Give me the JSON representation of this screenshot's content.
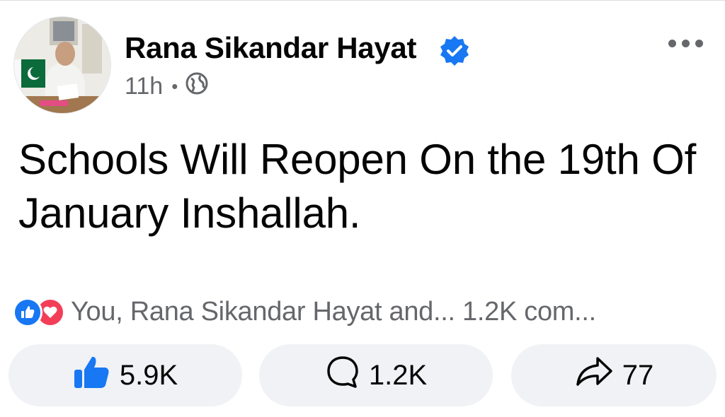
{
  "post": {
    "author": "Rana Sikandar Hayat",
    "time": "11h",
    "separator": "•",
    "text": "Schools Will Reopen On the 19th Of January Inshallah.",
    "reaction_summary": "You, Rana Sikandar Hayat and... 1.2K com..."
  },
  "actions": {
    "like_count": "5.9K",
    "comment_count": "1.2K",
    "share_count": "77"
  },
  "icons": {
    "verified": "verified-badge-icon",
    "privacy": "globe-icon",
    "more": "more-options-icon",
    "like_reaction": "like-reaction-icon",
    "love_reaction": "love-reaction-icon",
    "like": "thumbs-up-icon",
    "comment": "comment-bubble-icon",
    "share": "share-arrow-icon"
  },
  "colors": {
    "brand_blue": "#1877f2",
    "love_red": "#f33e58",
    "secondary_text": "#65676b",
    "button_bg": "#f0f2f5"
  }
}
